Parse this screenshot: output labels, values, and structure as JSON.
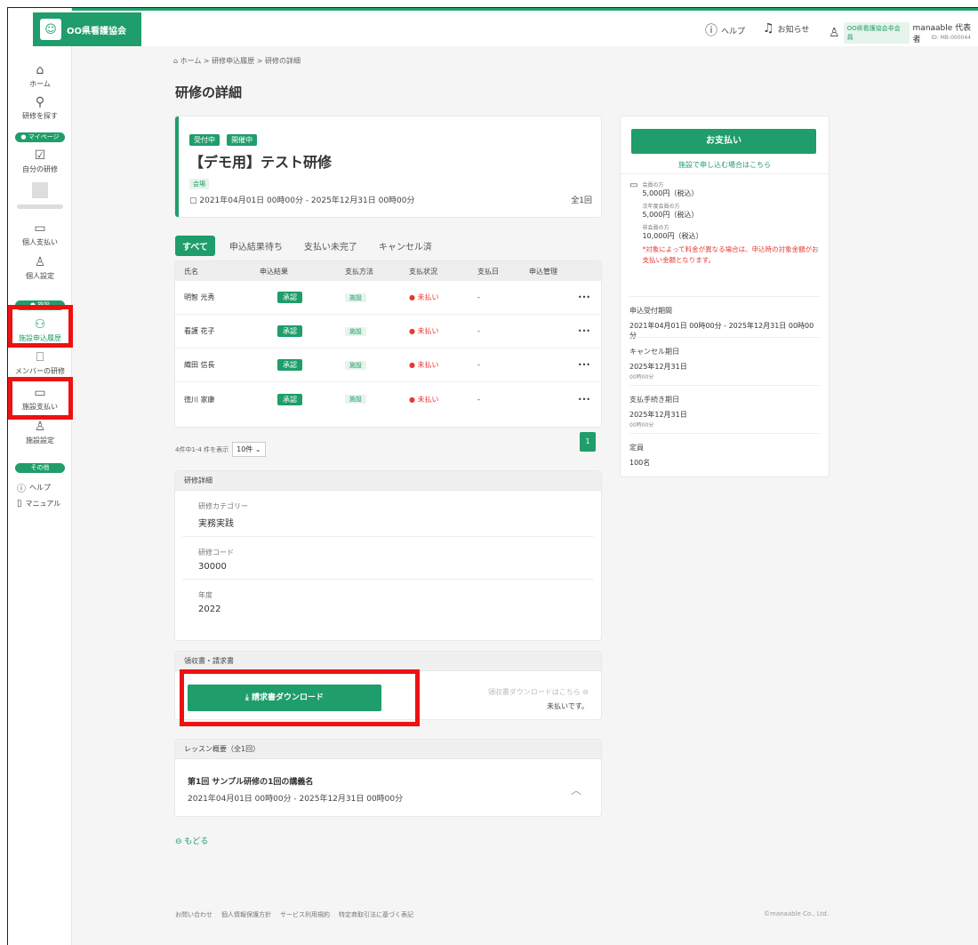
{
  "app": {
    "logo_icon": "cat-mascot-icon",
    "logo_text": "OO県看護協会"
  },
  "header": {
    "help_label": "ヘルプ",
    "notifications_label": "お知らせ",
    "user_badge": "OO県看護協会非会員",
    "user_name": "manaable 代表者",
    "user_id": "ID: MB-000044"
  },
  "sidebar": {
    "home_label": "ホーム",
    "search_label": "研修を探す",
    "mypage_section": "● マイページ",
    "my_trainings_label": "自分の研修",
    "personal_payment_label": "個人支払い",
    "personal_settings_label": "個人設定",
    "facility_section": "● 施設",
    "facility_applications_label": "施設申込履歴",
    "member_trainings_label": "メンバーの研修",
    "facility_payment_label": "施設支払い",
    "facility_settings_label": "施設設定",
    "other_section": "その他",
    "help_link": "ヘルプ",
    "manual_link": "マニュアル"
  },
  "breadcrumb": "ホーム > 研修申込履歴 > 研修の詳細",
  "page_title": "研修の詳細",
  "course": {
    "status_tags": [
      "受付中",
      "開催中"
    ],
    "title": "【デモ用】テスト研修",
    "venue_tag": "会場",
    "period": "2021年04月01日 00時00分 - 2025年12月31日 00時00分",
    "sessions": "全1回"
  },
  "tabs": [
    "すべて",
    "申込結果待ち",
    "支払い未完了",
    "キャンセル済"
  ],
  "table": {
    "headers": [
      "氏名",
      "申込結果",
      "支払方法",
      "支払状況",
      "支払日",
      "申込管理"
    ],
    "rows": [
      {
        "name": "明智 光秀",
        "result": "承認",
        "method": "施設",
        "status": "● 未払い",
        "date": "-",
        "menu": "•••"
      },
      {
        "name": "看護 花子",
        "result": "承認",
        "method": "施設",
        "status": "● 未払い",
        "date": "-",
        "menu": "•••"
      },
      {
        "name": "織田 信長",
        "result": "承認",
        "method": "施設",
        "status": "● 未払い",
        "date": "-",
        "menu": "•••"
      },
      {
        "name": "徳川 家康",
        "result": "承認",
        "method": "施設",
        "status": "● 未払い",
        "date": "-",
        "menu": "•••"
      }
    ]
  },
  "pagination": {
    "summary": "4件中1-4 件を表示",
    "per_page": "10件",
    "current_page": "1"
  },
  "details": {
    "heading": "研修詳細",
    "items": [
      {
        "label": "研修カテゴリー",
        "value": "実務実践"
      },
      {
        "label": "研修コード",
        "value": "30000"
      },
      {
        "label": "年度",
        "value": "2022"
      }
    ]
  },
  "receipt": {
    "heading": "領収書・請求書",
    "download_button": "請求書ダウンロード",
    "receipt_link": "領収書ダウンロードはこちら",
    "note": "未払いです。"
  },
  "lessons": {
    "heading": "レッスン概要（全1回）",
    "title": "第1回 サンプル研修の1回の講義名",
    "period": "2021年04月01日 00時00分 - 2025年12月31日 00時00分"
  },
  "back_label": "もどる",
  "payment": {
    "button": "お支払い",
    "sub_link": "施設で申し込む場合はこちら",
    "fees": [
      {
        "label": "会員の方",
        "value": "5,000円（税込）"
      },
      {
        "label": "次年度会員の方",
        "value": "5,000円（税込）"
      },
      {
        "label": "非会員の方",
        "value": "10,000円（税込）"
      }
    ],
    "note": "*対象によって料金が異なる場合は、申込時の対象金額がお支払い金額となります。",
    "application_period_label": "申込受付期間",
    "application_period": "2021年04月01日 00時00分 - 2025年12月31日 00時00分",
    "cancel_deadline_label": "キャンセル期日",
    "cancel_deadline": "2025年12月31日",
    "cancel_deadline_time": "00時00分",
    "payment_deadline_label": "支払手続き期日",
    "payment_deadline": "2025年12月31日",
    "payment_deadline_time": "00時00分",
    "capacity_label": "定員",
    "capacity": "100名"
  },
  "footer": {
    "links": [
      "お問い合わせ",
      "個人情報保護方針",
      "サービス利用規約",
      "特定商取引法に基づく表記"
    ],
    "copyright": "©manaable Co., Ltd."
  },
  "colors": {
    "accent": "#1f9d6a",
    "highlight": "#ee1111",
    "unpaid": "#e53935"
  }
}
